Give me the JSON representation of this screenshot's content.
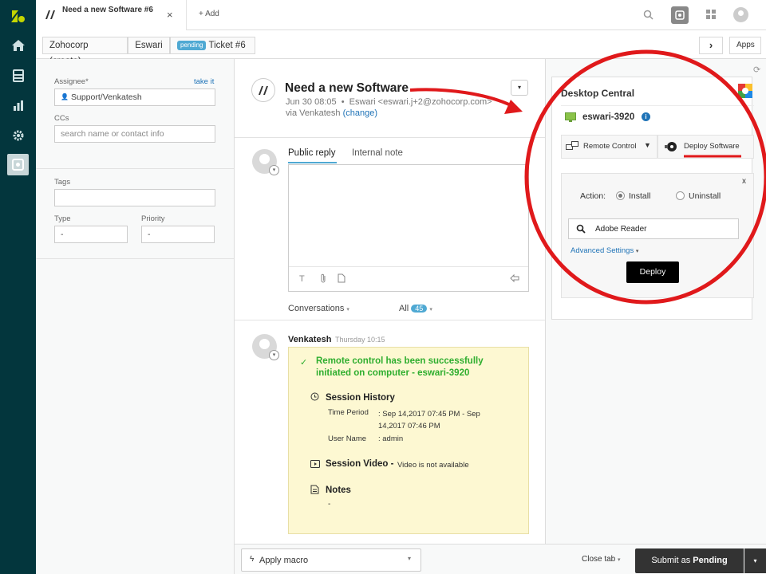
{
  "tab": {
    "title": "Need a new Software #6",
    "close": "×",
    "add_label": "+ Add"
  },
  "breadcrumb": {
    "org": "Zohocorp (create)",
    "requester": "Eswari",
    "status": "pending",
    "ticket": "Ticket #6"
  },
  "topright": {
    "apps_label": "Apps",
    "expand": "›"
  },
  "props": {
    "assignee_label": "Assignee*",
    "take_it": "take it",
    "assignee_value": "Support/Venkatesh",
    "ccs_label": "CCs",
    "ccs_placeholder": "search name or contact info",
    "tags_label": "Tags",
    "type_label": "Type",
    "type_value": "-",
    "priority_label": "Priority",
    "priority_value": "-"
  },
  "ticket": {
    "subject": "Need a new Software",
    "date": "Jun 30 08:05",
    "from": "Eswari <eswari.j+2@zohocorp.com>",
    "via": "via Venkatesh",
    "change": "(change)"
  },
  "reply": {
    "public_tab": "Public reply",
    "internal_tab": "Internal note"
  },
  "filter": {
    "conversations": "Conversations",
    "all": "All",
    "count": "45"
  },
  "comment": {
    "author": "Venkatesh",
    "time": "Thursday 10:15",
    "success": "Remote control has been successfully initiated on computer - eswari-3920",
    "session_history": "Session History",
    "time_period_label": "Time Period",
    "time_period_value": ": Sep 14,2017 07:45 PM  -  Sep 14,2017 07:46 PM",
    "user_name_label": "User Name",
    "user_name_value": ": admin",
    "session_video": "Session Video -",
    "video_note": "Video is not available",
    "notes": "Notes",
    "notes_value": "-"
  },
  "dc": {
    "title": "Desktop Central",
    "computer": "eswari-3920",
    "remote_control": "Remote Control",
    "deploy_software": "Deploy Software",
    "close": "x",
    "action_label": "Action:",
    "install": "Install",
    "uninstall": "Uninstall",
    "search_value": "Adobe Reader",
    "advanced": "Advanced Settings",
    "deploy_button": "Deploy"
  },
  "bottom": {
    "macro": "Apply macro",
    "close_tab": "Close tab",
    "submit_prefix": "Submit as ",
    "submit_status": "Pending"
  },
  "colors": {
    "nav": "#03363d",
    "annotation": "#e0191b",
    "link": "#1f73b7",
    "success": "#2fae2f",
    "note_bg": "#fdf8d2",
    "submit": "#333333"
  }
}
